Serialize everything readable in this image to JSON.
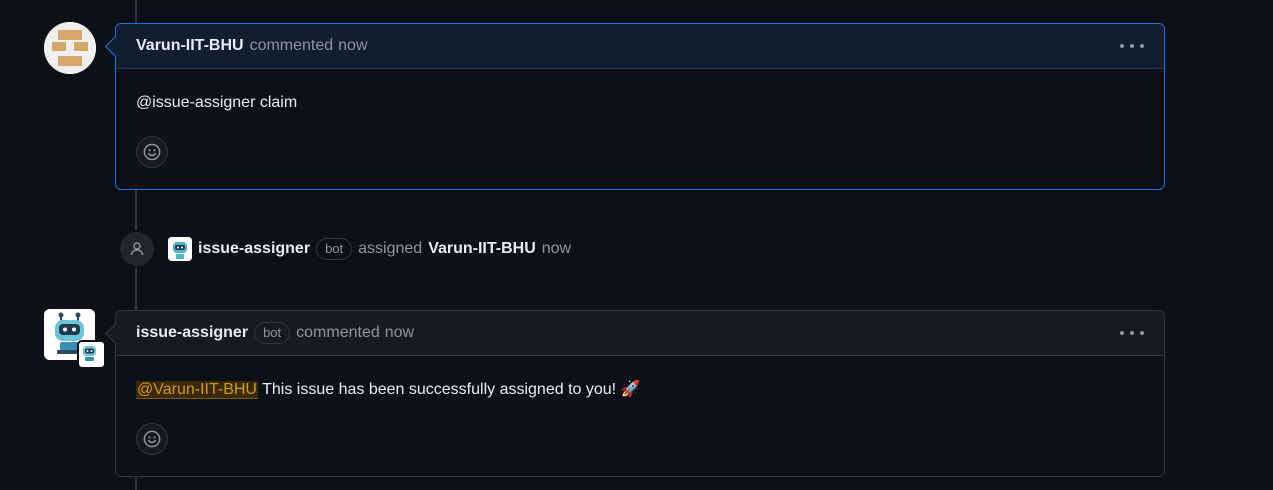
{
  "comment1": {
    "author": "Varun-IIT-BHU",
    "action": "commented",
    "time": "now",
    "body": "@issue-assigner claim",
    "avatar_icon": "identicon-avatar"
  },
  "event": {
    "actor": "issue-assigner",
    "badge": "bot",
    "action": "assigned",
    "target": "Varun-IIT-BHU",
    "time": "now",
    "icon": "person-icon"
  },
  "comment2": {
    "author": "issue-assigner",
    "badge": "bot",
    "action": "commented",
    "time": "now",
    "mention": "@Varun-IIT-BHU",
    "body": " This issue has been successfully assigned to you! 🚀",
    "avatar_icon": "robot-avatar"
  },
  "colors": {
    "background": "#0d1117",
    "highlight_border": "#1f6feb",
    "mention": "#d29922"
  }
}
